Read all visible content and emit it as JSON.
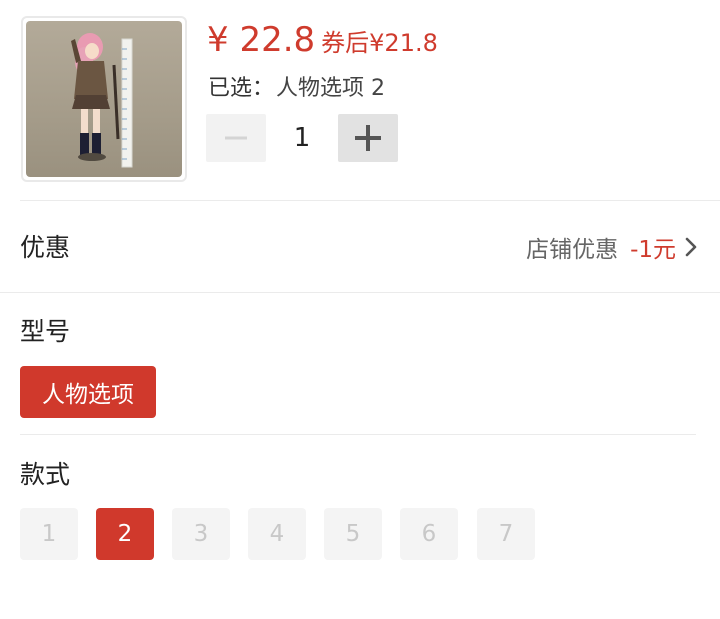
{
  "product": {
    "image_alt": "figure-photo",
    "price": "¥ 22.8",
    "coupon_label": "券后",
    "coupon_price": "¥21.8",
    "selected_prefix": "已选：",
    "selected_value": "人物选项 2"
  },
  "quantity": {
    "value": "1",
    "minus_icon": "minus-icon",
    "plus_icon": "plus-icon"
  },
  "promotion": {
    "title": "优惠",
    "shop_label": "店铺优惠",
    "amount": "-1元"
  },
  "model": {
    "title": "型号",
    "options": [
      "人物选项"
    ],
    "selected": "人物选项"
  },
  "style": {
    "title": "款式",
    "options": [
      "1",
      "2",
      "3",
      "4",
      "5",
      "6",
      "7"
    ],
    "selected": "2"
  },
  "colors": {
    "accent": "#d0392c",
    "price": "#cf3b2d",
    "chip_bg": "#f4f4f4",
    "chip_text_disabled": "#c8c8c8"
  }
}
